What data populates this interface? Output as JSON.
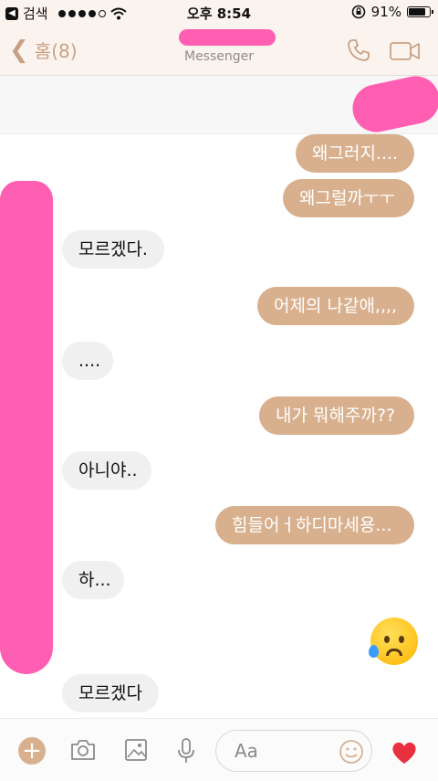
{
  "status_bar": {
    "back_app": "검색",
    "time": "오후 8:54",
    "battery": "91%",
    "battery_level": 0.91
  },
  "header": {
    "back_label": "홈(8)",
    "subtitle": "Messenger"
  },
  "messages": [
    {
      "side": "out",
      "text": "왜그러지...."
    },
    {
      "side": "out",
      "text": "왜그럴까ㅜㅜ"
    },
    {
      "side": "in",
      "text": "모르겠다."
    },
    {
      "side": "out",
      "text": "어제의 나같애,,,,"
    },
    {
      "side": "in",
      "text": "...."
    },
    {
      "side": "out",
      "text": "내가 뭐해주까??"
    },
    {
      "side": "in",
      "text": "아니야.."
    },
    {
      "side": "out",
      "text": "힘들어ㅓ하디마세용..."
    },
    {
      "side": "in",
      "text": "하..."
    },
    {
      "side": "out",
      "emoji": "sad-but-relieved-face"
    },
    {
      "side": "in",
      "text": "모르겠다"
    }
  ],
  "composer": {
    "placeholder": "Aa"
  },
  "colors": {
    "accent": "#d8b08e",
    "incoming_bubble": "#f1f0f0",
    "redaction": "#ff5fb2",
    "like": "#e8303e"
  }
}
